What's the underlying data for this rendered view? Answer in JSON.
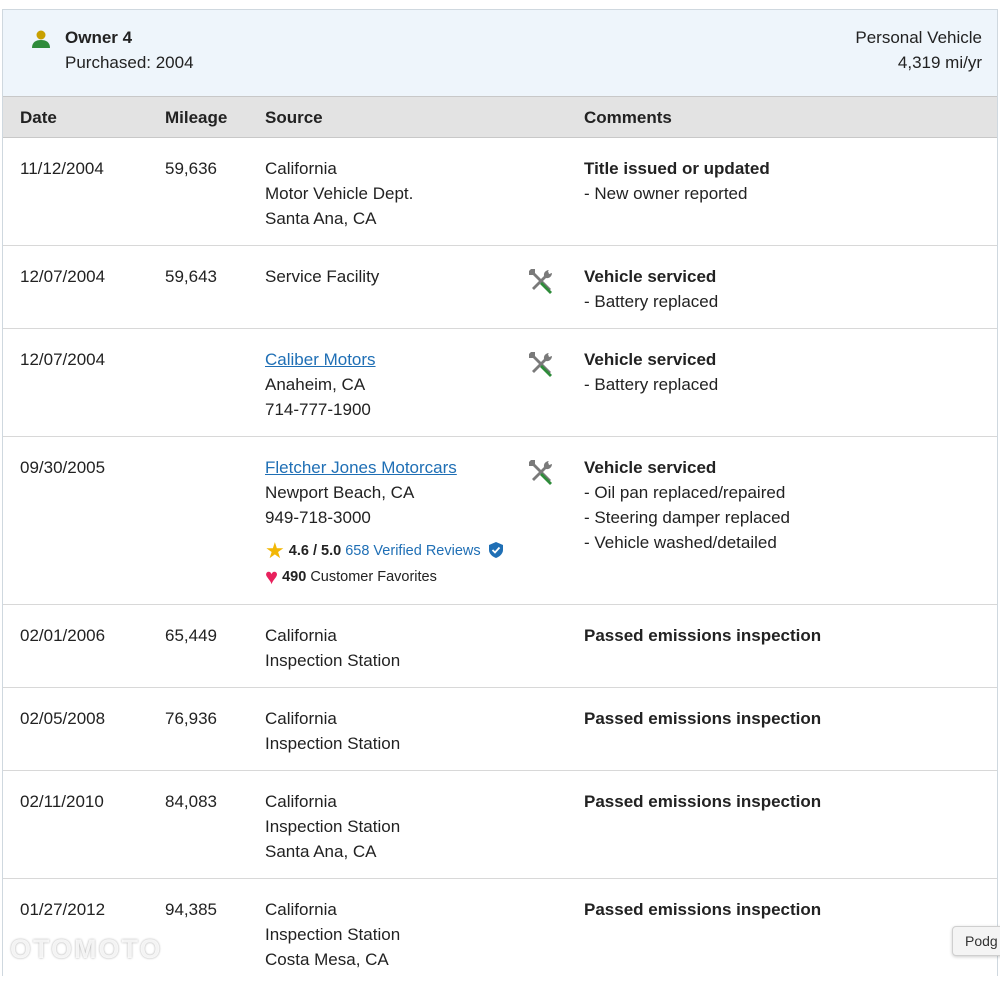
{
  "owner": {
    "title": "Owner 4",
    "purchased": "Purchased: 2004",
    "vehicle_type": "Personal Vehicle",
    "annual_mileage": "4,319 mi/yr",
    "icon": "person-icon"
  },
  "table": {
    "headers": {
      "date": "Date",
      "mileage": "Mileage",
      "source": "Source",
      "comments": "Comments"
    },
    "rows": [
      {
        "date": "11/12/2004",
        "mileage": "59,636",
        "source": [
          "California",
          "Motor Vehicle Dept.",
          "Santa Ana, CA"
        ],
        "comment_title": "Title issued or updated",
        "comments": [
          "New owner reported"
        ]
      },
      {
        "date": "12/07/2004",
        "mileage": "59,643",
        "source": [
          "Service Facility"
        ],
        "service_icon": "wrench-screwdriver-icon",
        "comment_title": "Vehicle serviced",
        "comments": [
          "Battery replaced"
        ]
      },
      {
        "date": "12/07/2004",
        "mileage": "",
        "source_link": "Caliber Motors",
        "source": [
          "Anaheim, CA",
          "714-777-1900"
        ],
        "service_icon": "wrench-screwdriver-icon",
        "comment_title": "Vehicle serviced",
        "comments": [
          "Battery replaced"
        ]
      },
      {
        "date": "09/30/2005",
        "mileage": "",
        "source_link": "Fletcher Jones Motorcars",
        "source": [
          "Newport Beach, CA",
          "949-718-3000"
        ],
        "rating": {
          "score": "4.6 / 5.0",
          "reviews_link": "658 Verified Reviews",
          "favorites_count": "490",
          "favorites_label": "Customer Favorites"
        },
        "service_icon": "wrench-screwdriver-icon",
        "comment_title": "Vehicle serviced",
        "comments": [
          "Oil pan replaced/repaired",
          "Steering damper replaced",
          "Vehicle washed/detailed"
        ]
      },
      {
        "date": "02/01/2006",
        "mileage": "65,449",
        "source": [
          "California",
          "Inspection Station"
        ],
        "comment_title": "Passed emissions inspection",
        "comments": []
      },
      {
        "date": "02/05/2008",
        "mileage": "76,936",
        "source": [
          "California",
          "Inspection Station"
        ],
        "comment_title": "Passed emissions inspection",
        "comments": []
      },
      {
        "date": "02/11/2010",
        "mileage": "84,083",
        "source": [
          "California",
          "Inspection Station",
          "Santa Ana, CA"
        ],
        "comment_title": "Passed emissions inspection",
        "comments": []
      },
      {
        "date": "01/27/2012",
        "mileage": "94,385",
        "source": [
          "California",
          "Inspection Station",
          "Costa Mesa, CA"
        ],
        "comment_title": "Passed emissions inspection",
        "comments": []
      }
    ]
  },
  "watermark": "OTOMOTO",
  "feedback_tab": "Podg",
  "colors": {
    "header_bg": "#eef5fb",
    "table_head_bg": "#e3e3e3",
    "link": "#1f6fb5",
    "icon_green": "#2e8b3a",
    "star": "#f2b705",
    "heart": "#e8215d"
  }
}
